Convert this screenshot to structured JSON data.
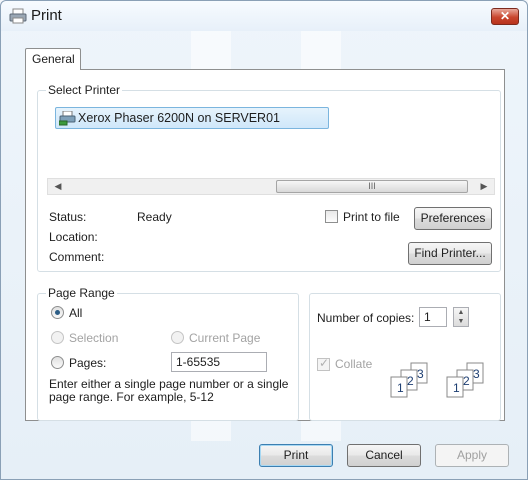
{
  "window": {
    "title": "Print",
    "close_label": "✕"
  },
  "tabs": [
    {
      "label": "General"
    }
  ],
  "select_printer": {
    "legend": "Select Printer",
    "printers": [
      {
        "name": "Xerox Phaser 6200N on SERVER01"
      }
    ],
    "scrollbar_grip": "III",
    "status_label": "Status:",
    "status_value": "Ready",
    "location_label": "Location:",
    "location_value": "",
    "comment_label": "Comment:",
    "comment_value": "",
    "print_to_file_label": "Print to file",
    "print_to_file_checked": false,
    "preferences_label": "Preferences",
    "find_printer_label": "Find Printer..."
  },
  "page_range": {
    "legend": "Page Range",
    "all_label": "All",
    "selection_label": "Selection",
    "current_page_label": "Current Page",
    "pages_label": "Pages:",
    "pages_value": "1-65535",
    "hint": "Enter either a single page number or a single page range.  For example, 5-12",
    "selected": "all"
  },
  "copies": {
    "label": "Number of copies:",
    "value": "1",
    "collate_label": "Collate",
    "collate_checked": true,
    "collate_pages_a": [
      "1",
      "2",
      "3"
    ],
    "collate_pages_b": [
      "1",
      "2",
      "3"
    ]
  },
  "footer": {
    "print_label": "Print",
    "cancel_label": "Cancel",
    "apply_label": "Apply"
  },
  "colors": {
    "accent": "#3c7fb1",
    "close_button": "#c9462e",
    "selected_item": "#cfe7fa"
  }
}
